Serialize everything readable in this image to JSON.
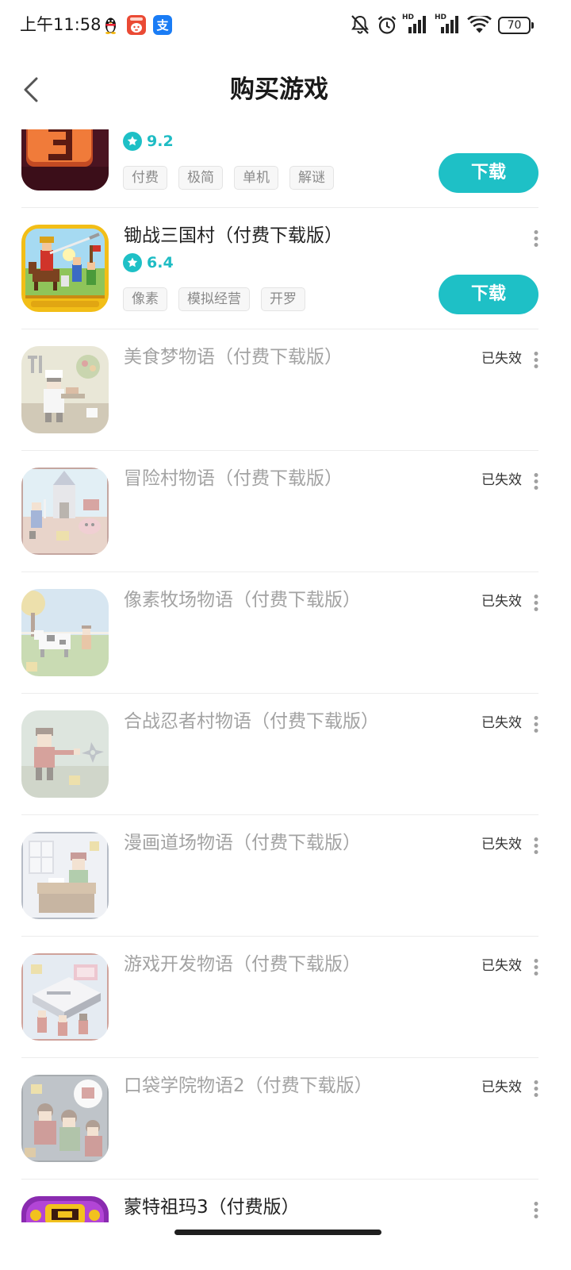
{
  "status_bar": {
    "time": "上午11:58",
    "notification_icons": [
      "qq-icon",
      "red-app-icon",
      "alipay-icon"
    ],
    "alipay_glyph": "支",
    "system_icons": [
      "mute-icon",
      "alarm-icon",
      "signal-icon",
      "signal-icon",
      "wifi-icon",
      "battery-icon"
    ],
    "signal_1_label": "HD",
    "signal_2_label": "HD",
    "battery_level": "70"
  },
  "header": {
    "back_icon": "chevron-left-icon",
    "title": "购买游戏"
  },
  "colors": {
    "accent": "#1ec0c6",
    "title_text": "#222222",
    "expired_title_text": "#a3a3a3",
    "tag_text": "#8a8a8a",
    "status_text": "#333333"
  },
  "row_icons": {
    "rating": "star-icon",
    "more": "more-vertical-icon"
  },
  "games": [
    {
      "icon": "game-icon",
      "rating": "9.2",
      "tags": [
        "付费",
        "极简",
        "单机",
        "解谜"
      ],
      "action_label": "下载",
      "expired": false
    },
    {
      "icon": "game-icon",
      "title": "锄战三国村（付费下载版）",
      "rating": "6.4",
      "tags": [
        "像素",
        "模拟经营",
        "开罗"
      ],
      "action_label": "下载",
      "expired": false
    },
    {
      "icon": "game-icon",
      "title": "美食梦物语（付费下载版）",
      "status_label": "已失效",
      "expired": true
    },
    {
      "icon": "game-icon",
      "title": "冒险村物语（付费下载版）",
      "status_label": "已失效",
      "expired": true
    },
    {
      "icon": "game-icon",
      "title": "像素牧场物语（付费下载版）",
      "status_label": "已失效",
      "expired": true
    },
    {
      "icon": "game-icon",
      "title": "合战忍者村物语（付费下载版）",
      "status_label": "已失效",
      "expired": true
    },
    {
      "icon": "game-icon",
      "title": "漫画道场物语（付费下载版）",
      "status_label": "已失效",
      "expired": true
    },
    {
      "icon": "game-icon",
      "title": "游戏开发物语（付费下载版）",
      "status_label": "已失效",
      "expired": true
    },
    {
      "icon": "game-icon",
      "title": "口袋学院物语2（付费下载版）",
      "status_label": "已失效",
      "expired": true
    },
    {
      "icon": "game-icon",
      "title": "蒙特祖玛3（付费版）",
      "expired": false
    }
  ]
}
